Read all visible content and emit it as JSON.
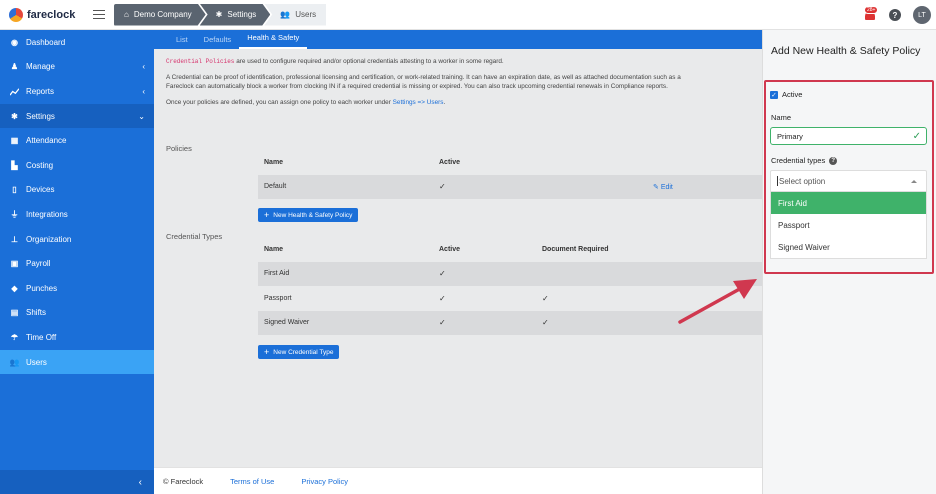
{
  "app": {
    "logo": "fareclock"
  },
  "breadcrumb": [
    {
      "label": "Demo Company",
      "icon": "home-icon"
    },
    {
      "label": "Settings",
      "icon": "gear-icon"
    },
    {
      "label": "Users",
      "icon": "users-icon"
    }
  ],
  "topbar": {
    "notification_count": "28+",
    "help": "?",
    "avatar_initials": "LT"
  },
  "sidebar": {
    "items": [
      {
        "label": "Dashboard",
        "icon": "dashboard-icon"
      },
      {
        "label": "Manage",
        "icon": "person-icon",
        "chevron": "‹"
      },
      {
        "label": "Reports",
        "icon": "chart-icon",
        "chevron": "‹"
      },
      {
        "label": "Settings",
        "icon": "gear-icon",
        "chevron": "⌄"
      },
      {
        "label": "Attendance",
        "icon": "attendance-icon"
      },
      {
        "label": "Costing",
        "icon": "costing-icon"
      },
      {
        "label": "Devices",
        "icon": "device-icon"
      },
      {
        "label": "Integrations",
        "icon": "plug-icon"
      },
      {
        "label": "Organization",
        "icon": "org-icon"
      },
      {
        "label": "Payroll",
        "icon": "payroll-icon"
      },
      {
        "label": "Punches",
        "icon": "punch-icon"
      },
      {
        "label": "Shifts",
        "icon": "shifts-icon"
      },
      {
        "label": "Time Off",
        "icon": "umbrella-icon"
      },
      {
        "label": "Users",
        "icon": "users-icon"
      }
    ],
    "collapse": "‹"
  },
  "tabs": [
    "List",
    "Defaults",
    "Health & Safety"
  ],
  "intro": {
    "code": "Credential Policies",
    "p1": " are used to configure required and/or optional credentials attesting to a worker in some regard.",
    "p2a": "A Credential can be proof of identification, professional licensing and certification, or work-related training. It can have an expiration date, as well as attached documentation such as a",
    "p2b": "Fareclock can automatically block a worker from clocking IN if a required credential is missing or expired. You can also track upcoming credential renewals in Compliance reports.",
    "p3": "Once your policies are defined, you can assign one policy to each worker under ",
    "p3_link": "Settings => Users",
    "p3_end": "."
  },
  "policies": {
    "label": "Policies",
    "headers": {
      "name": "Name",
      "active": "Active"
    },
    "rows": [
      {
        "name": "Default",
        "active": "✓",
        "action": "Edit"
      }
    ],
    "button": "New Health & Safety Policy"
  },
  "credential_types": {
    "label": "Credential Types",
    "headers": {
      "name": "Name",
      "active": "Active",
      "doc": "Document Required"
    },
    "rows": [
      {
        "name": "First Aid",
        "active": "✓",
        "doc": ""
      },
      {
        "name": "Passport",
        "active": "✓",
        "doc": "✓"
      },
      {
        "name": "Signed Waiver",
        "active": "✓",
        "doc": "✓"
      }
    ],
    "button": "New Credential Type"
  },
  "footer": {
    "copyright": "© Fareclock",
    "terms": "Terms of Use",
    "privacy": "Privacy Policy"
  },
  "panel": {
    "title": "Add New Health & Safety Policy",
    "active_label": "Active",
    "name_label": "Name",
    "name_value": "Primary",
    "credential_label": "Credential types",
    "select_placeholder": "Select option",
    "options": [
      "First Aid",
      "Passport",
      "Signed Waiver"
    ]
  },
  "colors": {
    "brand": "#1b6fd8",
    "success": "#3fb26a",
    "highlight": "#d0384f"
  }
}
